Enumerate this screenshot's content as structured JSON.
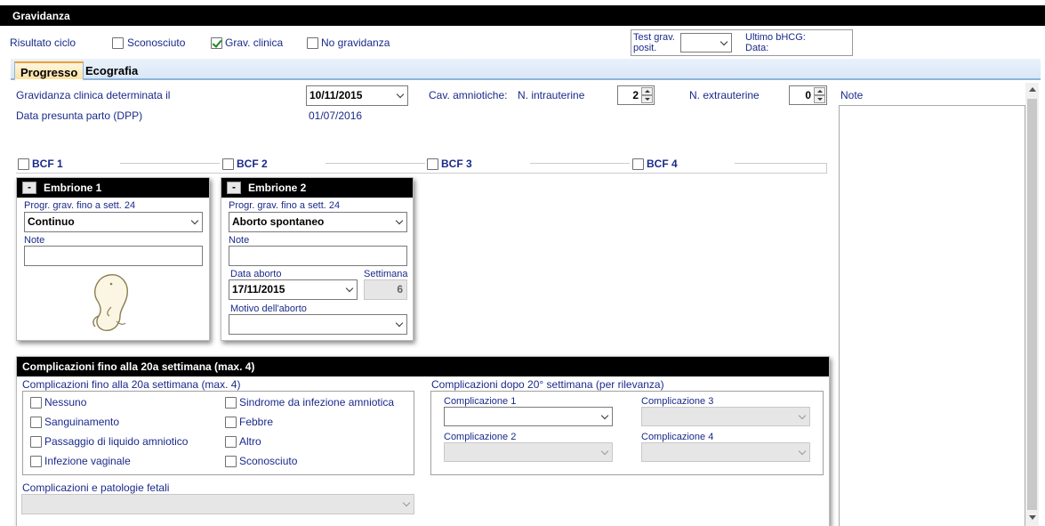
{
  "window": {
    "title": "Gravidanza"
  },
  "risultato": {
    "label": "Risultato ciclo",
    "options": [
      {
        "label": "Sconosciuto",
        "checked": false
      },
      {
        "label": "Grav. clinica",
        "checked": true
      },
      {
        "label": "No gravidanza",
        "checked": false
      }
    ]
  },
  "test": {
    "label1": "Test grav.",
    "label2": "posit.",
    "value": "",
    "bhcg1": "Ultimo bHCG:",
    "bhcg2": "Data:"
  },
  "tabs": [
    {
      "label": "Progresso",
      "active": true
    },
    {
      "label": "Ecografia",
      "active": false
    }
  ],
  "form": {
    "grav_label": "Gravidanza clinica determinata il",
    "grav_date": "10/11/2015",
    "dpp_label": "Data presunta parto (DPP)",
    "dpp_value": "01/07/2016",
    "cav_label": "Cav. amniotiche:",
    "intra_label": "N. intrauterine",
    "intra_value": "2",
    "extra_label": "N. extrauterine",
    "extra_value": "0"
  },
  "note": {
    "label": "Note",
    "value": ""
  },
  "bcf": [
    {
      "label": "BCF 1"
    },
    {
      "label": "BCF 2"
    },
    {
      "label": "BCF 3"
    },
    {
      "label": "BCF 4"
    }
  ],
  "embryos": [
    {
      "title": "Embrione 1",
      "toggle": "-",
      "progr_label": "Progr. grav. fino a sett. 24",
      "progr_value": "Continuo",
      "note_label": "Note",
      "note_value": ""
    },
    {
      "title": "Embrione 2",
      "toggle": "-",
      "progr_label": "Progr. grav. fino a sett. 24",
      "progr_value": "Aborto spontaneo",
      "note_label": "Note",
      "note_value": "",
      "aborto_label": "Data aborto",
      "aborto_value": "17/11/2015",
      "settimana_label": "Settimana",
      "settimana_value": "6",
      "motivo_label": "Motivo dell'aborto",
      "motivo_value": ""
    }
  ],
  "complicazioni": {
    "header": "Complicazioni fino alla 20a settimana (max. 4)",
    "group_label": "Complicazioni fino alla 20a settimana (max. 4)",
    "left": [
      {
        "label": "Nessuno"
      },
      {
        "label": "Sanguinamento"
      },
      {
        "label": "Passaggio di liquido amniotico"
      },
      {
        "label": "Infezione vaginale"
      }
    ],
    "right": [
      {
        "label": "Sindrome da infezione amniotica"
      },
      {
        "label": "Febbre"
      },
      {
        "label": "Altro"
      },
      {
        "label": "Sconosciuto"
      }
    ],
    "dopo_label": "Complicazioni dopo 20° settimana (per rilevanza)",
    "c1": "Complicazione 1",
    "c2": "Complicazione 2",
    "c3": "Complicazione 3",
    "c4": "Complicazione 4",
    "fetali_label": "Complicazioni e patologie fetali",
    "fetali_value": ""
  }
}
